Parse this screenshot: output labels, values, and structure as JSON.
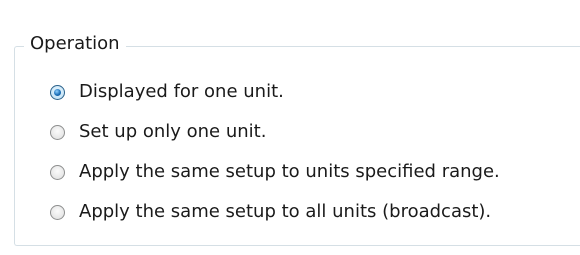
{
  "group": {
    "title": "Operation"
  },
  "options": [
    {
      "label": "Displayed for one unit.",
      "selected": true
    },
    {
      "label": "Set up only one unit.",
      "selected": false
    },
    {
      "label": "Apply the same setup to units specified range.",
      "selected": false
    },
    {
      "label": "Apply the same setup to all units (broadcast).",
      "selected": false
    }
  ],
  "colors": {
    "group_border": "#d5dfe5",
    "radio_checked_dot": "#1b6fb8",
    "text": "#1a1a1a"
  }
}
